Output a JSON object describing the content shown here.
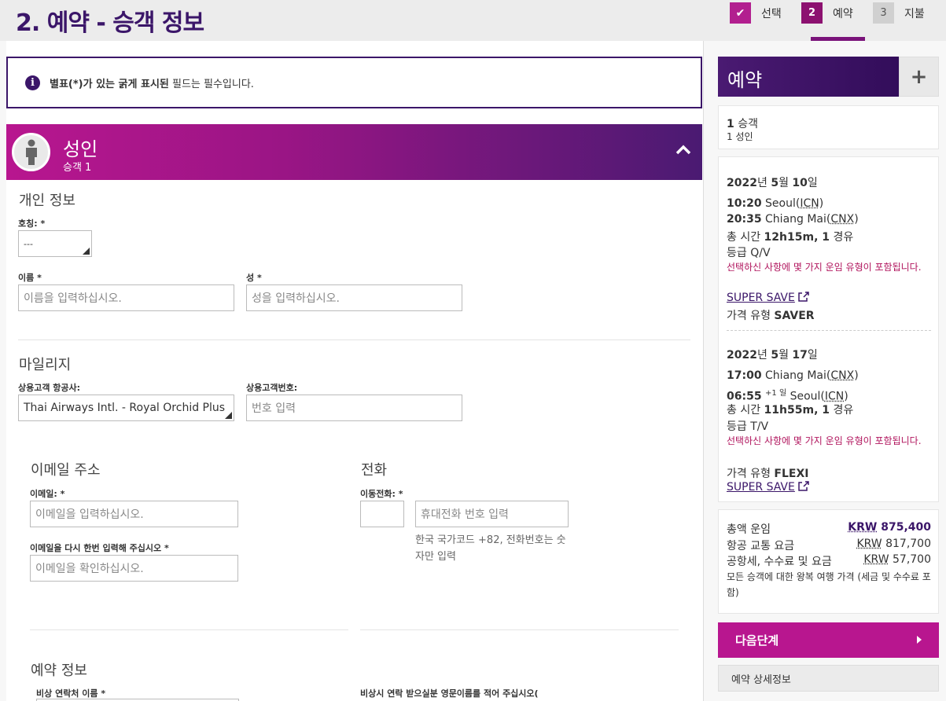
{
  "header": {
    "title": "2. 예약 - 승객 정보",
    "steps": [
      {
        "number": "✔",
        "label": "선택"
      },
      {
        "number": "2",
        "label": "예약"
      },
      {
        "number": "3",
        "label": "지불"
      }
    ]
  },
  "notice": {
    "bold_text": "별표(*)가 있는 굵게 표시된",
    "text": " 필드는 필수입니다."
  },
  "passenger": {
    "title": "성인",
    "subtitle": "승객 1"
  },
  "personal": {
    "section_title": "개인 정보",
    "salutation_label": "호칭: *",
    "salutation_value": "---",
    "first_name_label": "이름 *",
    "first_name_placeholder": "이름을 입력하십시오.",
    "last_name_label": "성 *",
    "last_name_placeholder": "성을 입력하십시오."
  },
  "mileage": {
    "section_title": "마일리지",
    "airline_label": "상용고객 항공사:",
    "airline_value": "Thai Airways Intl. - Royal Orchid Plus",
    "number_label": "상용고객번호:",
    "number_placeholder": "번호 입력"
  },
  "email": {
    "section_title": "이메일 주소",
    "email_label": "이메일: *",
    "email_placeholder": "이메일을 입력하십시오.",
    "confirm_label": "이메일을 다시 한번 입력해 주십시오 *",
    "confirm_placeholder": "이메일을 확인하십시오."
  },
  "phone": {
    "section_title": "전화",
    "mobile_label": "이동전화: *",
    "mobile_placeholder": "휴대전화 번호 입력",
    "hint": "한국 국가코드 +82, 전화번호는 숫자만 입력"
  },
  "booking_info": {
    "section_title": "예약 정보",
    "emergency_label": "비상 연락처 이름 *",
    "emergency_hint": "비상시 연락 받으실분 영문이름를 적어 주십시오("
  },
  "cart": {
    "title": "예약",
    "plus": "+",
    "pax_count": "1",
    "pax_label": " 승객",
    "pax_detail": "1 성인",
    "outbound": {
      "date_year": "2022",
      "date_year_unit": "년 ",
      "date_month": "5",
      "date_month_unit": "월 ",
      "date_day": "10",
      "date_day_unit": "일",
      "dep_time": "10:20",
      "dep_city": " Seoul(",
      "dep_code": "ICN",
      "arr_time": "20:35",
      "arr_city": " Chiang Mai(",
      "arr_code": "CNX",
      "duration_label": "총 시간 ",
      "duration": "12h15m, 1",
      "stops_label": " 경유",
      "class": "등급 Q/V",
      "fare_note": "선택하신 사항에 몇 가지 운임 유형이 포함됩니다.",
      "fare_link": "SUPER SAVE",
      "fare_type_label": "가격 유형 ",
      "fare_type": "SAVER"
    },
    "inbound": {
      "date_year": "2022",
      "date_year_unit": "년 ",
      "date_month": "5",
      "date_month_unit": "월 ",
      "date_day": "17",
      "date_day_unit": "일",
      "dep_time": "17:00",
      "dep_city": " Chiang Mai(",
      "dep_code": "CNX",
      "arr_time": "06:55",
      "arr_plus": "+1 일",
      "arr_city": " Seoul(",
      "arr_code": "ICN",
      "duration_label": "총 시간 ",
      "duration": "11h55m, 1",
      "stops_label": " 경유",
      "class": "등급 T/V",
      "fare_note": "선택하신 사항에 몇 가지 운임 유형이 포함됩니다.",
      "fare_type_label": "가격 유형 ",
      "fare_type": "FLEXI",
      "fare_link": "SUPER SAVE"
    },
    "prices": {
      "total_label": "총액 운임",
      "total_currency": "KRW",
      "total_value": "875,400",
      "air_label": "항공 교통 요금",
      "air_currency": "KRW",
      "air_value": "817,700",
      "tax_label": "공항세, 수수료 및 요금",
      "tax_currency": "KRW",
      "tax_value": "57,700",
      "note": "모든 승객에 대한 왕복 여행 가격 (세금 및 수수료 포함)"
    },
    "next_button": "다음단계",
    "details_button": "예약 상세정보"
  }
}
